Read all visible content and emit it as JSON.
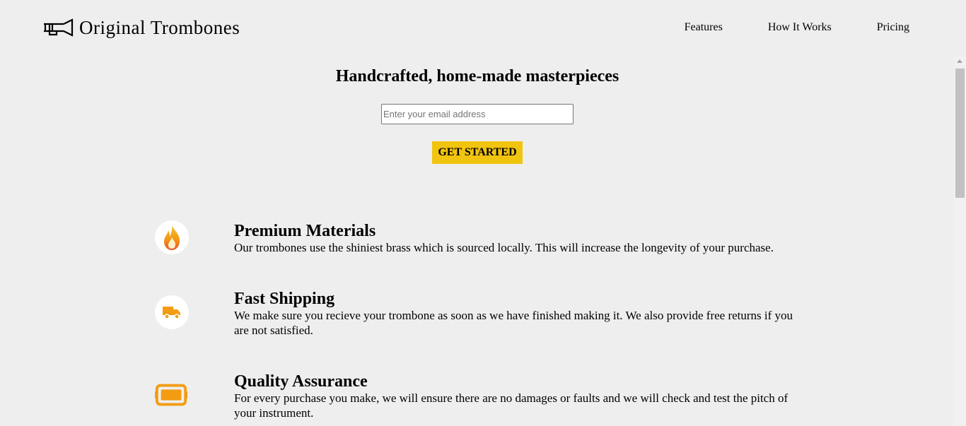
{
  "header": {
    "brand": "Original Trombones",
    "logo_icon": "trombone-logo-icon",
    "nav": [
      {
        "label": "Features"
      },
      {
        "label": "How It Works"
      },
      {
        "label": "Pricing"
      }
    ]
  },
  "hero": {
    "title": "Handcrafted, home-made masterpieces",
    "email_placeholder": "Enter your email address",
    "email_value": "",
    "cta_label": "GET STARTED",
    "cta_color": "#f1c40f"
  },
  "features": [
    {
      "icon": "flame-icon",
      "title": "Premium Materials",
      "description": "Our trombones use the shiniest brass which is sourced locally. This will increase the longevity of your purchase."
    },
    {
      "icon": "truck-icon",
      "title": "Fast Shipping",
      "description": "We make sure you recieve your trombone as soon as we have finished making it. We also provide free returns if you are not satisfied."
    },
    {
      "icon": "battery-icon",
      "title": "Quality Assurance",
      "description": "For every purchase you make, we will ensure there are no damages or faults and we will check and test the pitch of your instrument."
    }
  ],
  "colors": {
    "background": "#eeeeee",
    "accent": "#f1c40f",
    "icon_orange": "#f39c12"
  }
}
